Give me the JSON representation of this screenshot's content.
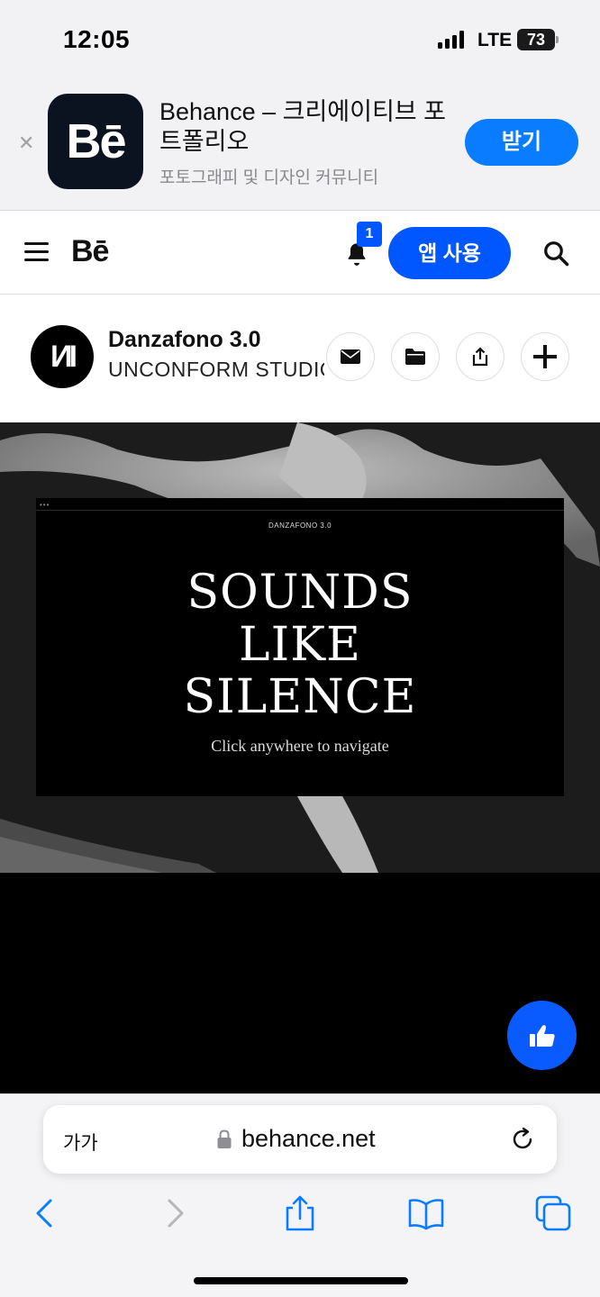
{
  "status_bar": {
    "time": "12:05",
    "network": "LTE",
    "battery": "73"
  },
  "app_banner": {
    "app_icon_text": "Bē",
    "title": "Behance – 크리에이티브 포트폴리오",
    "subtitle": "포토그래피 및 디자인 커뮤니티",
    "get_label": "받기",
    "close_icon": "close-icon"
  },
  "nav": {
    "logo": "Bē",
    "notification_count": "1",
    "use_app_label": "앱 사용",
    "icons": [
      "hamburger-menu-icon",
      "bell-icon",
      "search-icon"
    ]
  },
  "project": {
    "avatar_text": "ИI",
    "title": "Danzafono 3.0",
    "owner": "UNCONFORM STUDIO",
    "actions": [
      "mail-icon",
      "folder-icon",
      "share-icon",
      "plus-icon"
    ]
  },
  "hero": {
    "window_dots": "•••",
    "small_title": "DANZAFONO 3.0",
    "headline_line1": "SOUNDS",
    "headline_line2": "LIKE",
    "headline_line3": "SILENCE",
    "subtext": "Click anywhere to navigate"
  },
  "like_button": {
    "icon": "thumbs-up-icon"
  },
  "safari": {
    "text_size_label": "가가",
    "url": "behance.net",
    "toolbar": [
      "back-icon",
      "forward-icon",
      "share-icon",
      "bookmarks-icon",
      "tabs-icon"
    ]
  },
  "colors": {
    "primary_blue": "#0057ff",
    "banner_blue": "#0a7cff",
    "hero_bg": "#1c1c1c"
  }
}
